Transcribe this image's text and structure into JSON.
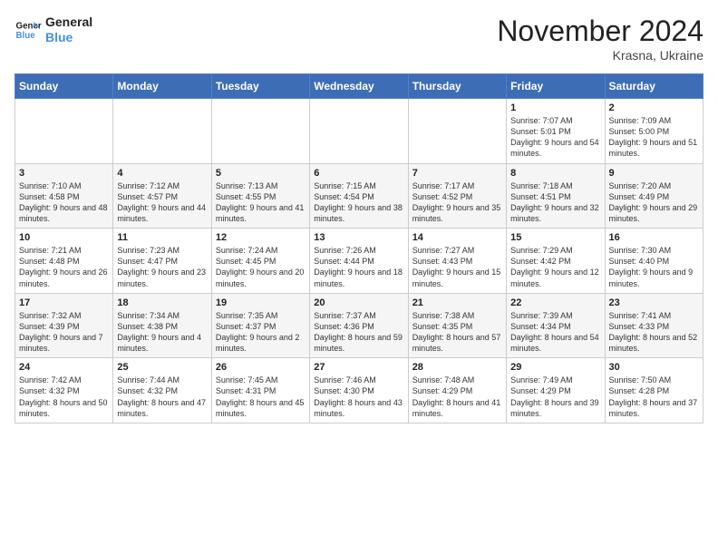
{
  "logo": {
    "line1": "General",
    "line2": "Blue"
  },
  "title": "November 2024",
  "location": "Krasna, Ukraine",
  "weekdays": [
    "Sunday",
    "Monday",
    "Tuesday",
    "Wednesday",
    "Thursday",
    "Friday",
    "Saturday"
  ],
  "weeks": [
    [
      {
        "day": "",
        "info": ""
      },
      {
        "day": "",
        "info": ""
      },
      {
        "day": "",
        "info": ""
      },
      {
        "day": "",
        "info": ""
      },
      {
        "day": "",
        "info": ""
      },
      {
        "day": "1",
        "info": "Sunrise: 7:07 AM\nSunset: 5:01 PM\nDaylight: 9 hours and 54 minutes."
      },
      {
        "day": "2",
        "info": "Sunrise: 7:09 AM\nSunset: 5:00 PM\nDaylight: 9 hours and 51 minutes."
      }
    ],
    [
      {
        "day": "3",
        "info": "Sunrise: 7:10 AM\nSunset: 4:58 PM\nDaylight: 9 hours and 48 minutes."
      },
      {
        "day": "4",
        "info": "Sunrise: 7:12 AM\nSunset: 4:57 PM\nDaylight: 9 hours and 44 minutes."
      },
      {
        "day": "5",
        "info": "Sunrise: 7:13 AM\nSunset: 4:55 PM\nDaylight: 9 hours and 41 minutes."
      },
      {
        "day": "6",
        "info": "Sunrise: 7:15 AM\nSunset: 4:54 PM\nDaylight: 9 hours and 38 minutes."
      },
      {
        "day": "7",
        "info": "Sunrise: 7:17 AM\nSunset: 4:52 PM\nDaylight: 9 hours and 35 minutes."
      },
      {
        "day": "8",
        "info": "Sunrise: 7:18 AM\nSunset: 4:51 PM\nDaylight: 9 hours and 32 minutes."
      },
      {
        "day": "9",
        "info": "Sunrise: 7:20 AM\nSunset: 4:49 PM\nDaylight: 9 hours and 29 minutes."
      }
    ],
    [
      {
        "day": "10",
        "info": "Sunrise: 7:21 AM\nSunset: 4:48 PM\nDaylight: 9 hours and 26 minutes."
      },
      {
        "day": "11",
        "info": "Sunrise: 7:23 AM\nSunset: 4:47 PM\nDaylight: 9 hours and 23 minutes."
      },
      {
        "day": "12",
        "info": "Sunrise: 7:24 AM\nSunset: 4:45 PM\nDaylight: 9 hours and 20 minutes."
      },
      {
        "day": "13",
        "info": "Sunrise: 7:26 AM\nSunset: 4:44 PM\nDaylight: 9 hours and 18 minutes."
      },
      {
        "day": "14",
        "info": "Sunrise: 7:27 AM\nSunset: 4:43 PM\nDaylight: 9 hours and 15 minutes."
      },
      {
        "day": "15",
        "info": "Sunrise: 7:29 AM\nSunset: 4:42 PM\nDaylight: 9 hours and 12 minutes."
      },
      {
        "day": "16",
        "info": "Sunrise: 7:30 AM\nSunset: 4:40 PM\nDaylight: 9 hours and 9 minutes."
      }
    ],
    [
      {
        "day": "17",
        "info": "Sunrise: 7:32 AM\nSunset: 4:39 PM\nDaylight: 9 hours and 7 minutes."
      },
      {
        "day": "18",
        "info": "Sunrise: 7:34 AM\nSunset: 4:38 PM\nDaylight: 9 hours and 4 minutes."
      },
      {
        "day": "19",
        "info": "Sunrise: 7:35 AM\nSunset: 4:37 PM\nDaylight: 9 hours and 2 minutes."
      },
      {
        "day": "20",
        "info": "Sunrise: 7:37 AM\nSunset: 4:36 PM\nDaylight: 8 hours and 59 minutes."
      },
      {
        "day": "21",
        "info": "Sunrise: 7:38 AM\nSunset: 4:35 PM\nDaylight: 8 hours and 57 minutes."
      },
      {
        "day": "22",
        "info": "Sunrise: 7:39 AM\nSunset: 4:34 PM\nDaylight: 8 hours and 54 minutes."
      },
      {
        "day": "23",
        "info": "Sunrise: 7:41 AM\nSunset: 4:33 PM\nDaylight: 8 hours and 52 minutes."
      }
    ],
    [
      {
        "day": "24",
        "info": "Sunrise: 7:42 AM\nSunset: 4:32 PM\nDaylight: 8 hours and 50 minutes."
      },
      {
        "day": "25",
        "info": "Sunrise: 7:44 AM\nSunset: 4:32 PM\nDaylight: 8 hours and 47 minutes."
      },
      {
        "day": "26",
        "info": "Sunrise: 7:45 AM\nSunset: 4:31 PM\nDaylight: 8 hours and 45 minutes."
      },
      {
        "day": "27",
        "info": "Sunrise: 7:46 AM\nSunset: 4:30 PM\nDaylight: 8 hours and 43 minutes."
      },
      {
        "day": "28",
        "info": "Sunrise: 7:48 AM\nSunset: 4:29 PM\nDaylight: 8 hours and 41 minutes."
      },
      {
        "day": "29",
        "info": "Sunrise: 7:49 AM\nSunset: 4:29 PM\nDaylight: 8 hours and 39 minutes."
      },
      {
        "day": "30",
        "info": "Sunrise: 7:50 AM\nSunset: 4:28 PM\nDaylight: 8 hours and 37 minutes."
      }
    ]
  ]
}
